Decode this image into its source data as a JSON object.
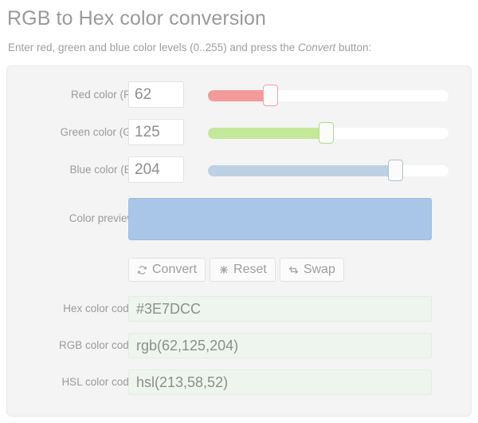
{
  "header": {
    "title": "RGB to Hex color conversion",
    "intro_before": "Enter red, green and blue color levels (0..255) and press the ",
    "intro_em": "Convert",
    "intro_after": " button:"
  },
  "inputs": [
    {
      "label": "Red color (R):",
      "value": "62",
      "name": "red",
      "fill_color": "#f49a9a",
      "handle_border": "#f0a3a3",
      "percent": 24.3
    },
    {
      "label": "Green color (G):",
      "value": "125",
      "name": "green",
      "fill_color": "#c3e89a",
      "handle_border": "#aedd86",
      "percent": 49.0
    },
    {
      "label": "Blue color (B):",
      "value": "204",
      "name": "blue",
      "fill_color": "#bed0e4",
      "handle_border": "#a6c2e0",
      "percent": 80.0
    }
  ],
  "preview": {
    "label": "Color preview:",
    "color": "#a9c5e8",
    "border_color": "#a0bcdf"
  },
  "buttons": [
    {
      "label": "Convert",
      "icon": "refresh-icon",
      "name": "convert"
    },
    {
      "label": "Reset",
      "icon": "cross-icon",
      "name": "reset"
    },
    {
      "label": "Swap",
      "icon": "swap-icon",
      "name": "swap"
    }
  ],
  "outputs": [
    {
      "label": "Hex color code:",
      "value": "#3E7DCC",
      "name": "hex"
    },
    {
      "label": "RGB color code:",
      "value": "rgb(62,125,204)",
      "name": "rgb"
    },
    {
      "label": "HSL color code:",
      "value": "hsl(213,58,52)",
      "name": "hsl"
    }
  ]
}
